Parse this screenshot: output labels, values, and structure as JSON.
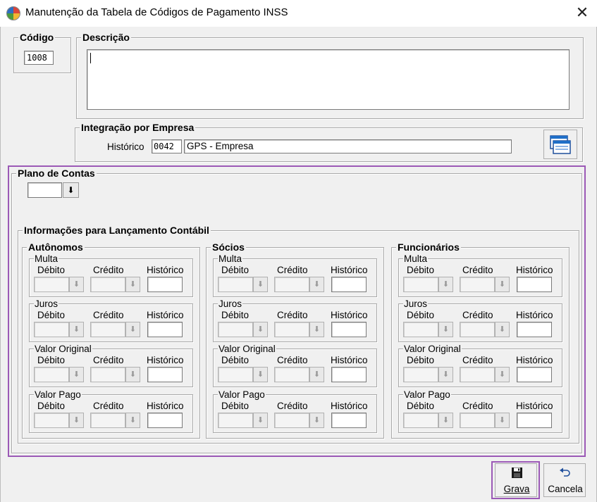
{
  "window": {
    "title": "Manutenção da Tabela de Códigos de Pagamento INSS",
    "close_glyph": "✕"
  },
  "codigo": {
    "label": "Código",
    "value": "1008"
  },
  "descricao": {
    "label": "Descrição",
    "value": ""
  },
  "integracao": {
    "label": "Integração  por Empresa",
    "historico_label": "Histórico",
    "historico_code": "0042",
    "historico_desc": "GPS - Empresa"
  },
  "plano": {
    "label": "Plano de Contas",
    "value": ""
  },
  "info": {
    "label": "Informações para Lançamento Contábil",
    "col_debito": "Débito",
    "col_credito": "Crédito",
    "col_historico": "Histórico",
    "groups": [
      {
        "label": "Autônomos",
        "subgroups": [
          "Multa",
          "Juros",
          "Valor Original",
          "Valor Pago"
        ]
      },
      {
        "label": "Sócios",
        "subgroups": [
          "Multa",
          "Juros",
          "Valor Original",
          "Valor Pago"
        ]
      },
      {
        "label": "Funcionários",
        "subgroups": [
          "Multa",
          "Juros",
          "Valor Original",
          "Valor Pago"
        ]
      }
    ]
  },
  "buttons": {
    "grava": "Grava",
    "cancela": "Cancela"
  },
  "colors": {
    "highlight": "#9b59b6",
    "window_bg": "#f0f0f0"
  }
}
